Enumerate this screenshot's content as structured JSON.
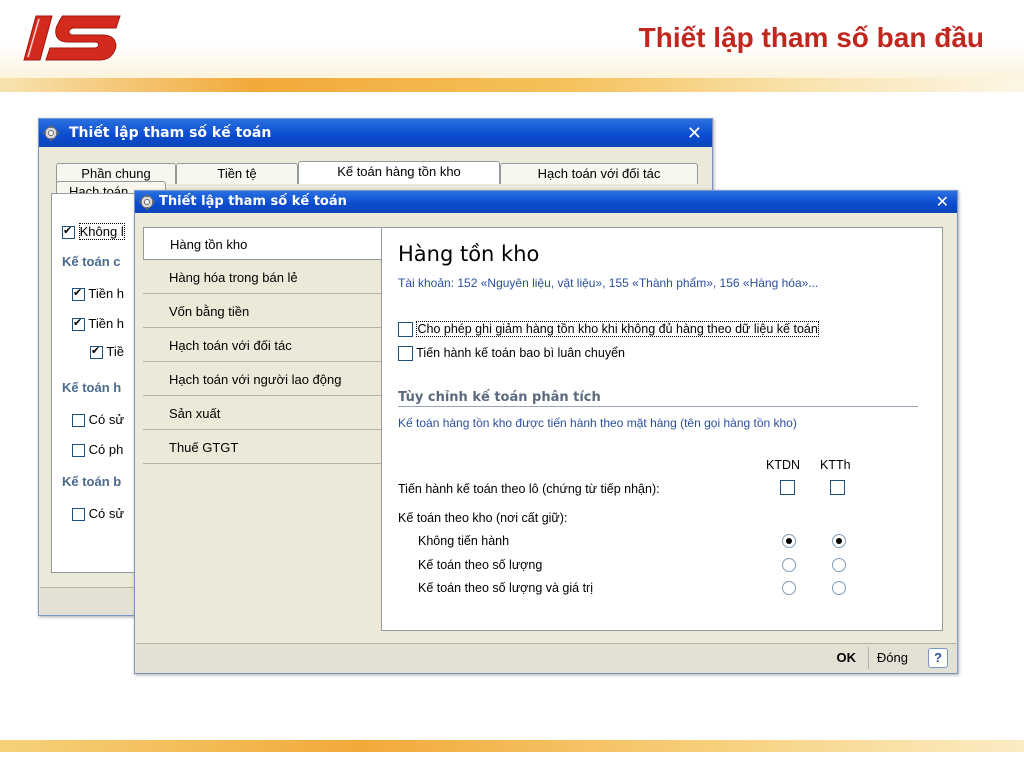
{
  "slide": {
    "title": "Thiết lập tham số ban đầu",
    "brand_color": "#c0281f"
  },
  "back_window": {
    "title": "Thiết lập tham số kế toán",
    "tabs_row1": [
      "Phần chung",
      "Tiền tệ",
      "Kế toán hàng tồn kho",
      "Hạch toán với đối tác"
    ],
    "tabs_row2": [
      "Hạch toán"
    ],
    "rows": [
      {
        "type": "checkbox",
        "checked": true,
        "label": "Không l"
      },
      {
        "type": "section",
        "label": "Kế toán c"
      },
      {
        "type": "checkbox",
        "checked": true,
        "label": "Tiền h"
      },
      {
        "type": "checkbox",
        "checked": true,
        "label": "Tiền h"
      },
      {
        "type": "checkbox",
        "checked": true,
        "label": "Tiề"
      },
      {
        "type": "section",
        "label": "Kế toán h"
      },
      {
        "type": "checkbox",
        "checked": false,
        "label": "Có sử"
      },
      {
        "type": "checkbox",
        "checked": false,
        "label": "Có ph"
      },
      {
        "type": "section",
        "label": "Kế toán b"
      },
      {
        "type": "checkbox",
        "checked": false,
        "label": "Có sử"
      }
    ]
  },
  "front_window": {
    "title": "Thiết lập tham số kế toán",
    "nav": [
      "Hàng tồn kho",
      "Hàng hóa trong bán lẻ",
      "Vốn bằng tiền",
      "Hạch toán với đối tác",
      "Hạch toán với người lao động",
      "Sản xuất",
      "Thuế GTGT"
    ],
    "panel": {
      "title": "Hàng tồn kho",
      "subtitle": "Tài khoản: 152 «Nguyên liệu, vật liệu», 155 «Thành phẩm», 156 «Hàng hóa»...",
      "opt1": "Cho phép ghi giảm hàng tồn kho khi không đủ hàng theo dữ liệu kế toán",
      "opt2": "Tiến hành kế toán bao bì luân chuyển",
      "section": "Tùy chỉnh kế toán phân tích",
      "section_desc": "Kế toán hàng tồn kho được tiến hành theo mặt hàng (tên gọi hàng tồn kho)",
      "col1": "KTDN",
      "col2": "KTTh",
      "lot_label": "Tiến hành kế toán theo lô (chứng từ tiếp nhận):",
      "warehouse_label": "Kế toán theo kho (nơi cất giữ):",
      "radio_rows": [
        {
          "label": "Không tiến hành",
          "col1": true,
          "col2": true
        },
        {
          "label": "Kế toán theo số lượng",
          "col1": false,
          "col2": false
        },
        {
          "label": "Kế toán theo số lượng và giá trị",
          "col1": false,
          "col2": false
        }
      ]
    },
    "buttons": {
      "ok": "OK",
      "close": "Đóng",
      "help": "?"
    }
  }
}
